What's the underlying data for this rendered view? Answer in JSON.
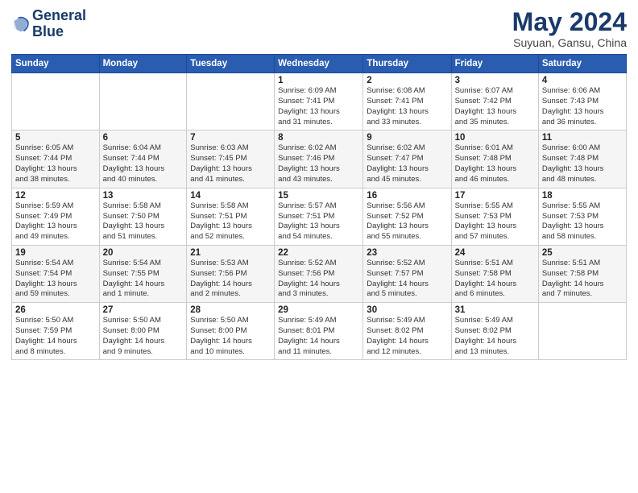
{
  "logo": {
    "line1": "General",
    "line2": "Blue"
  },
  "title": "May 2024",
  "location": "Suyuan, Gansu, China",
  "days_of_week": [
    "Sunday",
    "Monday",
    "Tuesday",
    "Wednesday",
    "Thursday",
    "Friday",
    "Saturday"
  ],
  "weeks": [
    [
      {
        "day": "",
        "info": ""
      },
      {
        "day": "",
        "info": ""
      },
      {
        "day": "",
        "info": ""
      },
      {
        "day": "1",
        "info": "Sunrise: 6:09 AM\nSunset: 7:41 PM\nDaylight: 13 hours\nand 31 minutes."
      },
      {
        "day": "2",
        "info": "Sunrise: 6:08 AM\nSunset: 7:41 PM\nDaylight: 13 hours\nand 33 minutes."
      },
      {
        "day": "3",
        "info": "Sunrise: 6:07 AM\nSunset: 7:42 PM\nDaylight: 13 hours\nand 35 minutes."
      },
      {
        "day": "4",
        "info": "Sunrise: 6:06 AM\nSunset: 7:43 PM\nDaylight: 13 hours\nand 36 minutes."
      }
    ],
    [
      {
        "day": "5",
        "info": "Sunrise: 6:05 AM\nSunset: 7:44 PM\nDaylight: 13 hours\nand 38 minutes."
      },
      {
        "day": "6",
        "info": "Sunrise: 6:04 AM\nSunset: 7:44 PM\nDaylight: 13 hours\nand 40 minutes."
      },
      {
        "day": "7",
        "info": "Sunrise: 6:03 AM\nSunset: 7:45 PM\nDaylight: 13 hours\nand 41 minutes."
      },
      {
        "day": "8",
        "info": "Sunrise: 6:02 AM\nSunset: 7:46 PM\nDaylight: 13 hours\nand 43 minutes."
      },
      {
        "day": "9",
        "info": "Sunrise: 6:02 AM\nSunset: 7:47 PM\nDaylight: 13 hours\nand 45 minutes."
      },
      {
        "day": "10",
        "info": "Sunrise: 6:01 AM\nSunset: 7:48 PM\nDaylight: 13 hours\nand 46 minutes."
      },
      {
        "day": "11",
        "info": "Sunrise: 6:00 AM\nSunset: 7:48 PM\nDaylight: 13 hours\nand 48 minutes."
      }
    ],
    [
      {
        "day": "12",
        "info": "Sunrise: 5:59 AM\nSunset: 7:49 PM\nDaylight: 13 hours\nand 49 minutes."
      },
      {
        "day": "13",
        "info": "Sunrise: 5:58 AM\nSunset: 7:50 PM\nDaylight: 13 hours\nand 51 minutes."
      },
      {
        "day": "14",
        "info": "Sunrise: 5:58 AM\nSunset: 7:51 PM\nDaylight: 13 hours\nand 52 minutes."
      },
      {
        "day": "15",
        "info": "Sunrise: 5:57 AM\nSunset: 7:51 PM\nDaylight: 13 hours\nand 54 minutes."
      },
      {
        "day": "16",
        "info": "Sunrise: 5:56 AM\nSunset: 7:52 PM\nDaylight: 13 hours\nand 55 minutes."
      },
      {
        "day": "17",
        "info": "Sunrise: 5:55 AM\nSunset: 7:53 PM\nDaylight: 13 hours\nand 57 minutes."
      },
      {
        "day": "18",
        "info": "Sunrise: 5:55 AM\nSunset: 7:53 PM\nDaylight: 13 hours\nand 58 minutes."
      }
    ],
    [
      {
        "day": "19",
        "info": "Sunrise: 5:54 AM\nSunset: 7:54 PM\nDaylight: 13 hours\nand 59 minutes."
      },
      {
        "day": "20",
        "info": "Sunrise: 5:54 AM\nSunset: 7:55 PM\nDaylight: 14 hours\nand 1 minute."
      },
      {
        "day": "21",
        "info": "Sunrise: 5:53 AM\nSunset: 7:56 PM\nDaylight: 14 hours\nand 2 minutes."
      },
      {
        "day": "22",
        "info": "Sunrise: 5:52 AM\nSunset: 7:56 PM\nDaylight: 14 hours\nand 3 minutes."
      },
      {
        "day": "23",
        "info": "Sunrise: 5:52 AM\nSunset: 7:57 PM\nDaylight: 14 hours\nand 5 minutes."
      },
      {
        "day": "24",
        "info": "Sunrise: 5:51 AM\nSunset: 7:58 PM\nDaylight: 14 hours\nand 6 minutes."
      },
      {
        "day": "25",
        "info": "Sunrise: 5:51 AM\nSunset: 7:58 PM\nDaylight: 14 hours\nand 7 minutes."
      }
    ],
    [
      {
        "day": "26",
        "info": "Sunrise: 5:50 AM\nSunset: 7:59 PM\nDaylight: 14 hours\nand 8 minutes."
      },
      {
        "day": "27",
        "info": "Sunrise: 5:50 AM\nSunset: 8:00 PM\nDaylight: 14 hours\nand 9 minutes."
      },
      {
        "day": "28",
        "info": "Sunrise: 5:50 AM\nSunset: 8:00 PM\nDaylight: 14 hours\nand 10 minutes."
      },
      {
        "day": "29",
        "info": "Sunrise: 5:49 AM\nSunset: 8:01 PM\nDaylight: 14 hours\nand 11 minutes."
      },
      {
        "day": "30",
        "info": "Sunrise: 5:49 AM\nSunset: 8:02 PM\nDaylight: 14 hours\nand 12 minutes."
      },
      {
        "day": "31",
        "info": "Sunrise: 5:49 AM\nSunset: 8:02 PM\nDaylight: 14 hours\nand 13 minutes."
      },
      {
        "day": "",
        "info": ""
      }
    ]
  ]
}
